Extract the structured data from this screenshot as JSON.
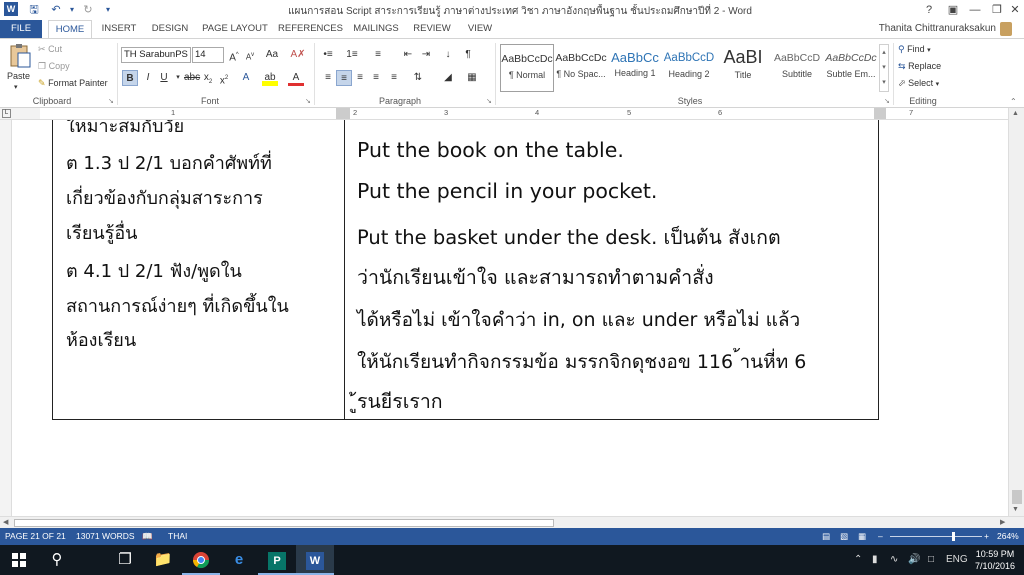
{
  "window": {
    "title": "แผนการสอน  Script  สาระการเรียนรู้  ภาษาต่างประเทศ  วิชา  ภาษาอังกฤษพื้นฐาน  ชั้นประถมศึกษาปีที่ 2 - Word",
    "user": "Thanita Chittranuraksakun",
    "help": "?"
  },
  "tabs": [
    "FILE",
    "HOME",
    "INSERT",
    "DESIGN",
    "PAGE LAYOUT",
    "REFERENCES",
    "MAILINGS",
    "REVIEW",
    "VIEW"
  ],
  "ribbon": {
    "clipboard": {
      "paste": "Paste",
      "cut": "Cut",
      "copy": "Copy",
      "format_painter": "Format Painter",
      "label": "Clipboard"
    },
    "font": {
      "name": "TH SarabunPS",
      "size": "14",
      "label": "Font"
    },
    "paragraph": {
      "label": "Paragraph"
    },
    "styles": {
      "label": "Styles",
      "items": [
        {
          "sample": "AaBbCcDc",
          "name": "¶ Normal"
        },
        {
          "sample": "AaBbCcDc",
          "name": "¶ No Spac..."
        },
        {
          "sample": "AaBbCc",
          "name": "Heading 1"
        },
        {
          "sample": "AaBbCcD",
          "name": "Heading 2"
        },
        {
          "sample": "AaBI",
          "name": "Title"
        },
        {
          "sample": "AaBbCcD",
          "name": "Subtitle"
        },
        {
          "sample": "AaBbCcDc",
          "name": "Subtle Em..."
        }
      ]
    },
    "editing": {
      "find": "Find",
      "replace": "Replace",
      "select": "Select",
      "label": "Editing"
    }
  },
  "ruler": {
    "numbers": [
      "1",
      "2",
      "3",
      "4",
      "5",
      "6",
      "7"
    ]
  },
  "document": {
    "left_cell": [
      "ใหมาะสมกับวัย",
      "ต 1.3  ป 2/1 บอกคำศัพท์ที่",
      "เกี่ยวข้องกับกลุ่มสาระการ",
      "เรียนรู้อื่น",
      "ต 4.1  ป 2/1 ฟัง/พูดใน",
      "สถานการณ์ง่ายๆ ที่เกิดขึ้นใน",
      "ห้องเรียน"
    ],
    "right_cell": [
      "Put the book on the table.",
      "Put the pencil in your pocket.",
      "Put the basket under the desk. เป็นต้น  สังเกต",
      "ว่านักเรียนเข้าใจ และสามารถทำตามคำสั่ง",
      "ได้หรือไม่ เข้าใจคำว่า in, on และ under หรือไม่ แล้ว",
      "ให้นักเรียนทำกิจกรรมข้อ มรรกจิกดุชงอข 116 ้านหี่ท 6",
      "ู้รนยีรเราก"
    ]
  },
  "status": {
    "page": "PAGE 21 OF 21",
    "words": "13071 WORDS",
    "language": "THAI",
    "zoom": "264%"
  },
  "taskbar": {
    "lang": "ENG",
    "time": "10:59 PM",
    "date": "7/10/2016"
  },
  "colors": {
    "accent": "#2b579a",
    "taskbar": "#101820"
  }
}
